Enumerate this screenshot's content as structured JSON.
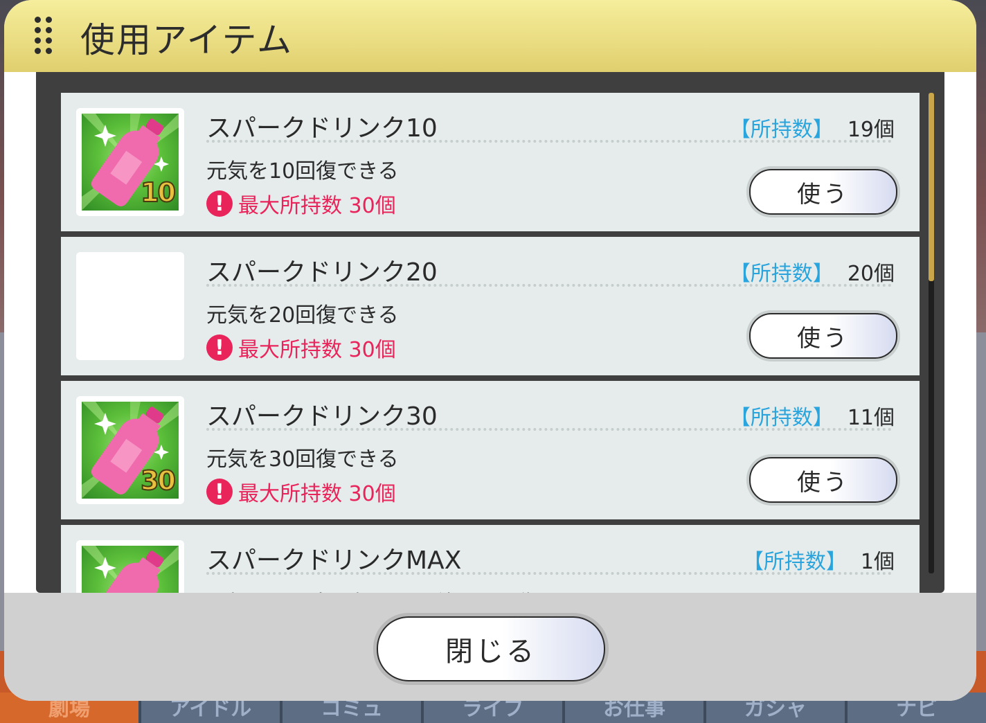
{
  "dialog": {
    "title": "使用アイテム",
    "close_label": "閉じる"
  },
  "items": [
    {
      "name": "スパークドリンク10",
      "owned_label": "【所持数】",
      "owned_count": "19個",
      "description": "元気を10回復できる",
      "warning": "最大所持数 30個",
      "use_label": "使う",
      "badge": "10",
      "has_image": true
    },
    {
      "name": "スパークドリンク20",
      "owned_label": "【所持数】",
      "owned_count": "20個",
      "description": "元気を20回復できる",
      "warning": "最大所持数 30個",
      "use_label": "使う",
      "badge": "",
      "has_image": false
    },
    {
      "name": "スパークドリンク30",
      "owned_label": "【所持数】",
      "owned_count": "11個",
      "description": "元気を30回復できる",
      "warning": "最大所持数 30個",
      "use_label": "使う",
      "badge": "30",
      "has_image": true
    },
    {
      "name": "スパークドリンクMAX",
      "owned_label": "【所持数】",
      "owned_count": "1個",
      "description": "元気を、最大元気と同じ値だけ回復する",
      "has_image": true
    }
  ],
  "nav": {
    "items": [
      "劇場",
      "アイドル",
      "コミュ",
      "ライブ",
      "お仕事",
      "ガシャ",
      "ナビ"
    ]
  },
  "colors": {
    "header": "#e0cf6e",
    "owned_label": "#2aa4dc",
    "warning": "#e8245a",
    "thumb_bg": "#5cbf3a"
  }
}
